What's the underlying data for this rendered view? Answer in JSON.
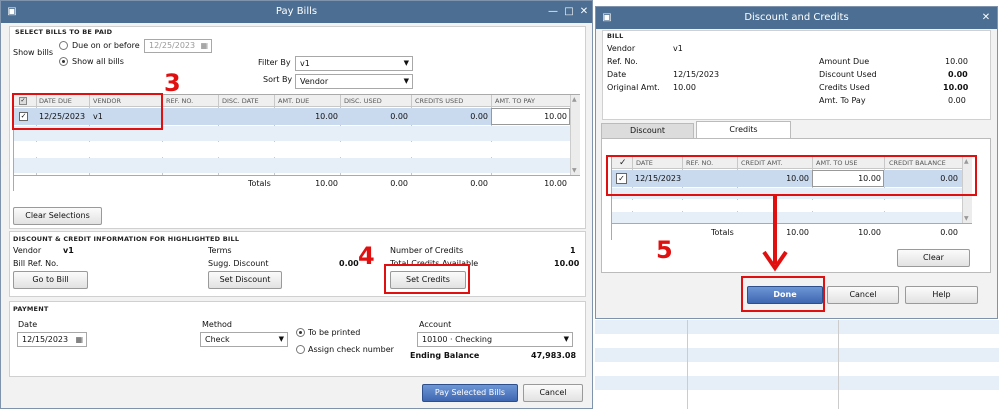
{
  "pay_bills": {
    "title": "Pay Bills",
    "select_section": "SELECT BILLS TO BE PAID",
    "show_bills_label": "Show bills",
    "due_on_before_label": "Due on or before",
    "due_date_value": "12/25/2023",
    "show_all_label": "Show all bills",
    "filter_by_label": "Filter By",
    "filter_by_value": "v1",
    "sort_by_label": "Sort By",
    "sort_by_value": "Vendor",
    "columns": [
      "DATE DUE",
      "VENDOR",
      "REF. NO.",
      "DISC. DATE",
      "AMT. DUE",
      "DISC. USED",
      "CREDITS USED",
      "AMT. TO PAY"
    ],
    "row": {
      "date_due": "12/25/2023",
      "vendor": "v1",
      "amt_due": "10.00",
      "disc_used": "0.00",
      "credits_used": "0.00",
      "amt_to_pay": "10.00"
    },
    "totals_label": "Totals",
    "totals": {
      "amt_due": "10.00",
      "disc_used": "0.00",
      "credits_used": "0.00",
      "amt_to_pay": "10.00"
    },
    "clear_selections": "Clear Selections",
    "discount_section": "DISCOUNT & CREDIT INFORMATION FOR HIGHLIGHTED BILL",
    "vendor_label": "Vendor",
    "vendor_value": "v1",
    "bill_ref_label": "Bill Ref. No.",
    "terms_label": "Terms",
    "sugg_discount_label": "Sugg. Discount",
    "sugg_discount_value": "0.00",
    "num_credits_label": "Number of Credits",
    "num_credits_value": "1",
    "total_credits_label": "Total Credits Available",
    "total_credits_value": "10.00",
    "go_to_bill": "Go to Bill",
    "set_discount": "Set Discount",
    "set_credits": "Set Credits",
    "payment_section": "PAYMENT",
    "date_label": "Date",
    "date_value": "12/15/2023",
    "method_label": "Method",
    "method_value": "Check",
    "to_be_printed": "To be printed",
    "assign_check": "Assign check number",
    "account_label": "Account",
    "account_value": "10100 · Checking",
    "ending_balance_label": "Ending Balance",
    "ending_balance_value": "47,983.08",
    "pay_selected": "Pay Selected Bills",
    "cancel": "Cancel"
  },
  "disc_credits": {
    "title": "Discount and Credits",
    "bill_section": "BILL",
    "vendor_label": "Vendor",
    "vendor_value": "v1",
    "ref_label": "Ref. No.",
    "date_label": "Date",
    "date_value": "12/15/2023",
    "orig_amt_label": "Original Amt.",
    "orig_amt_value": "10.00",
    "amount_due_label": "Amount Due",
    "amount_due_value": "10.00",
    "discount_used_label": "Discount Used",
    "discount_used_value": "0.00",
    "credits_used_label": "Credits Used",
    "credits_used_value": "10.00",
    "amt_to_pay_label": "Amt. To Pay",
    "amt_to_pay_value": "0.00",
    "tab_discount": "Discount",
    "tab_credits": "Credits",
    "check_header": "✓",
    "columns": [
      "DATE",
      "REF. NO.",
      "CREDIT AMT.",
      "AMT. TO USE",
      "CREDIT BALANCE"
    ],
    "row": {
      "date": "12/15/2023",
      "credit_amt": "10.00",
      "amt_to_use": "10.00",
      "credit_balance": "0.00"
    },
    "totals_label": "Totals",
    "totals": {
      "credit_amt": "10.00",
      "amt_to_use": "10.00",
      "credit_balance": "0.00"
    },
    "clear": "Clear",
    "done": "Done",
    "cancel": "Cancel",
    "help": "Help"
  },
  "annotations": {
    "step3": "3",
    "step4": "4",
    "step5": "5"
  },
  "colors": {
    "title_bar": "#4c6e92",
    "annotation_red": "#e01010",
    "row_highlight": "#c9d9ee",
    "row_alt": "#e6eef8"
  }
}
